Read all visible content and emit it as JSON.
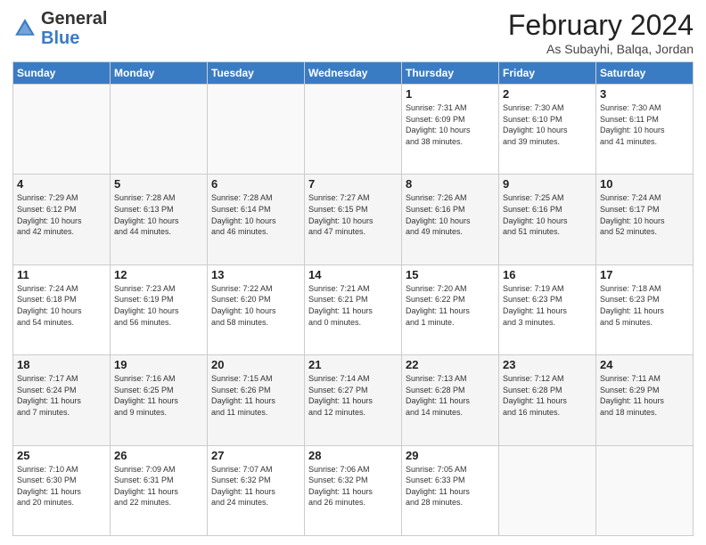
{
  "header": {
    "logo_general": "General",
    "logo_blue": "Blue",
    "title": "February 2024",
    "location": "As Subayhi, Balqa, Jordan"
  },
  "weekdays": [
    "Sunday",
    "Monday",
    "Tuesday",
    "Wednesday",
    "Thursday",
    "Friday",
    "Saturday"
  ],
  "weeks": [
    [
      {
        "day": "",
        "info": ""
      },
      {
        "day": "",
        "info": ""
      },
      {
        "day": "",
        "info": ""
      },
      {
        "day": "",
        "info": ""
      },
      {
        "day": "1",
        "info": "Sunrise: 7:31 AM\nSunset: 6:09 PM\nDaylight: 10 hours\nand 38 minutes."
      },
      {
        "day": "2",
        "info": "Sunrise: 7:30 AM\nSunset: 6:10 PM\nDaylight: 10 hours\nand 39 minutes."
      },
      {
        "day": "3",
        "info": "Sunrise: 7:30 AM\nSunset: 6:11 PM\nDaylight: 10 hours\nand 41 minutes."
      }
    ],
    [
      {
        "day": "4",
        "info": "Sunrise: 7:29 AM\nSunset: 6:12 PM\nDaylight: 10 hours\nand 42 minutes."
      },
      {
        "day": "5",
        "info": "Sunrise: 7:28 AM\nSunset: 6:13 PM\nDaylight: 10 hours\nand 44 minutes."
      },
      {
        "day": "6",
        "info": "Sunrise: 7:28 AM\nSunset: 6:14 PM\nDaylight: 10 hours\nand 46 minutes."
      },
      {
        "day": "7",
        "info": "Sunrise: 7:27 AM\nSunset: 6:15 PM\nDaylight: 10 hours\nand 47 minutes."
      },
      {
        "day": "8",
        "info": "Sunrise: 7:26 AM\nSunset: 6:16 PM\nDaylight: 10 hours\nand 49 minutes."
      },
      {
        "day": "9",
        "info": "Sunrise: 7:25 AM\nSunset: 6:16 PM\nDaylight: 10 hours\nand 51 minutes."
      },
      {
        "day": "10",
        "info": "Sunrise: 7:24 AM\nSunset: 6:17 PM\nDaylight: 10 hours\nand 52 minutes."
      }
    ],
    [
      {
        "day": "11",
        "info": "Sunrise: 7:24 AM\nSunset: 6:18 PM\nDaylight: 10 hours\nand 54 minutes."
      },
      {
        "day": "12",
        "info": "Sunrise: 7:23 AM\nSunset: 6:19 PM\nDaylight: 10 hours\nand 56 minutes."
      },
      {
        "day": "13",
        "info": "Sunrise: 7:22 AM\nSunset: 6:20 PM\nDaylight: 10 hours\nand 58 minutes."
      },
      {
        "day": "14",
        "info": "Sunrise: 7:21 AM\nSunset: 6:21 PM\nDaylight: 11 hours\nand 0 minutes."
      },
      {
        "day": "15",
        "info": "Sunrise: 7:20 AM\nSunset: 6:22 PM\nDaylight: 11 hours\nand 1 minute."
      },
      {
        "day": "16",
        "info": "Sunrise: 7:19 AM\nSunset: 6:23 PM\nDaylight: 11 hours\nand 3 minutes."
      },
      {
        "day": "17",
        "info": "Sunrise: 7:18 AM\nSunset: 6:23 PM\nDaylight: 11 hours\nand 5 minutes."
      }
    ],
    [
      {
        "day": "18",
        "info": "Sunrise: 7:17 AM\nSunset: 6:24 PM\nDaylight: 11 hours\nand 7 minutes."
      },
      {
        "day": "19",
        "info": "Sunrise: 7:16 AM\nSunset: 6:25 PM\nDaylight: 11 hours\nand 9 minutes."
      },
      {
        "day": "20",
        "info": "Sunrise: 7:15 AM\nSunset: 6:26 PM\nDaylight: 11 hours\nand 11 minutes."
      },
      {
        "day": "21",
        "info": "Sunrise: 7:14 AM\nSunset: 6:27 PM\nDaylight: 11 hours\nand 12 minutes."
      },
      {
        "day": "22",
        "info": "Sunrise: 7:13 AM\nSunset: 6:28 PM\nDaylight: 11 hours\nand 14 minutes."
      },
      {
        "day": "23",
        "info": "Sunrise: 7:12 AM\nSunset: 6:28 PM\nDaylight: 11 hours\nand 16 minutes."
      },
      {
        "day": "24",
        "info": "Sunrise: 7:11 AM\nSunset: 6:29 PM\nDaylight: 11 hours\nand 18 minutes."
      }
    ],
    [
      {
        "day": "25",
        "info": "Sunrise: 7:10 AM\nSunset: 6:30 PM\nDaylight: 11 hours\nand 20 minutes."
      },
      {
        "day": "26",
        "info": "Sunrise: 7:09 AM\nSunset: 6:31 PM\nDaylight: 11 hours\nand 22 minutes."
      },
      {
        "day": "27",
        "info": "Sunrise: 7:07 AM\nSunset: 6:32 PM\nDaylight: 11 hours\nand 24 minutes."
      },
      {
        "day": "28",
        "info": "Sunrise: 7:06 AM\nSunset: 6:32 PM\nDaylight: 11 hours\nand 26 minutes."
      },
      {
        "day": "29",
        "info": "Sunrise: 7:05 AM\nSunset: 6:33 PM\nDaylight: 11 hours\nand 28 minutes."
      },
      {
        "day": "",
        "info": ""
      },
      {
        "day": "",
        "info": ""
      }
    ]
  ]
}
